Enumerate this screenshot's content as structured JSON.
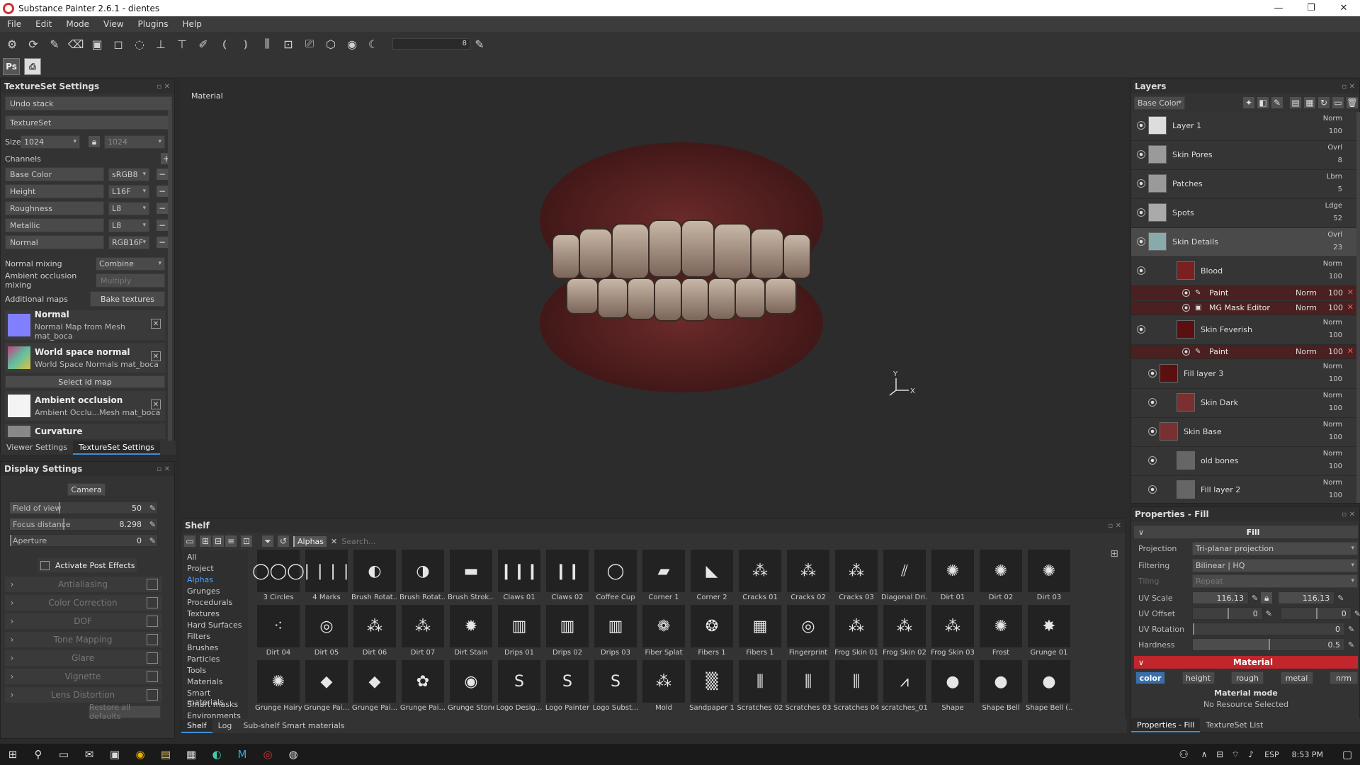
{
  "window": {
    "title": "Substance Painter 2.6.1 - dientes",
    "minimize": "—",
    "maximize": "❐",
    "close": "✕"
  },
  "menu": [
    "File",
    "Edit",
    "Mode",
    "View",
    "Plugins",
    "Help"
  ],
  "toolbar": {
    "brush_size": "8",
    "ps_label": "Ps"
  },
  "textureset": {
    "title": "TextureSet Settings",
    "undo_stack": "Undo stack",
    "textureset_label": "TextureSet",
    "size_label": "Size",
    "size_value": "1024",
    "size_value2": "1024",
    "channels_label": "Channels",
    "channels": [
      {
        "name": "Base Color",
        "format": "sRGB8"
      },
      {
        "name": "Height",
        "format": "L16F"
      },
      {
        "name": "Roughness",
        "format": "L8"
      },
      {
        "name": "Metallic",
        "format": "L8"
      },
      {
        "name": "Normal",
        "format": "RGB16F"
      }
    ],
    "normal_mixing_label": "Normal mixing",
    "normal_mixing_value": "Combine",
    "ao_mixing_label": "Ambient occlusion mixing",
    "ao_mixing_value": "Multiply",
    "additional_maps_label": "Additional maps",
    "bake_button": "Bake textures",
    "maps": [
      {
        "title": "Normal",
        "desc": "Normal Map from Mesh mat_boca",
        "color": "#8080ff"
      },
      {
        "title": "World space normal",
        "desc": "World Space Normals mat_boca",
        "color": "#c060a0"
      }
    ],
    "select_id_map": "Select id map",
    "maps2": [
      {
        "title": "Ambient occlusion",
        "desc": "Ambient Occlu...Mesh mat_boca"
      },
      {
        "title": "Curvature",
        "desc": ""
      }
    ],
    "tabs": [
      "Viewer Settings",
      "TextureSet Settings"
    ]
  },
  "display": {
    "title": "Display Settings",
    "camera_button": "Camera",
    "sliders": [
      {
        "label": "Field of view",
        "value": "50",
        "fraction": 0.33
      },
      {
        "label": "Focus distance",
        "value": "8.298",
        "fraction": 0.36
      },
      {
        "label": "Aperture",
        "value": "0",
        "fraction": 0.0
      }
    ],
    "activate_post": "Activate Post Effects",
    "effects": [
      "Antialiasing",
      "Color Correction",
      "DOF",
      "Tone Mapping",
      "Glare",
      "Vignette",
      "Lens Distortion"
    ],
    "restore": "Restore all defaults"
  },
  "viewport": {
    "label": "Material",
    "axis_y": "Y",
    "axis_x": "X"
  },
  "layers": {
    "title": "Layers",
    "channel": "Base Color",
    "items": [
      {
        "name": "Layer 1",
        "blend": "Norm",
        "opacity": "100"
      },
      {
        "name": "Skin Pores",
        "blend": "Ovrl",
        "opacity": "8"
      },
      {
        "name": "Patches",
        "blend": "Lbrn",
        "opacity": "5"
      },
      {
        "name": "Spots",
        "blend": "Ldge",
        "opacity": "52"
      },
      {
        "name": "Skin Details",
        "blend": "Ovrl",
        "opacity": "23"
      },
      {
        "name": "Blood",
        "blend": "Norm",
        "opacity": "100"
      }
    ],
    "blood_subs": [
      {
        "name": "Paint",
        "blend": "Norm",
        "opacity": "100"
      },
      {
        "name": "MG Mask Editor",
        "blend": "Norm",
        "opacity": "100"
      }
    ],
    "feverish": {
      "name": "Skin Feverish",
      "blend": "Norm",
      "opacity": "100"
    },
    "feverish_sub": {
      "name": "Paint",
      "blend": "Norm",
      "opacity": "100"
    },
    "items2": [
      {
        "name": "Fill layer 3",
        "blend": "Norm",
        "opacity": "100"
      },
      {
        "name": "Skin Dark",
        "blend": "Norm",
        "opacity": "100"
      },
      {
        "name": "Skin Base",
        "blend": "Norm",
        "opacity": "100"
      },
      {
        "name": "old bones",
        "blend": "Norm",
        "opacity": "100"
      },
      {
        "name": "Fill layer 2",
        "blend": "Norm",
        "opacity": "100"
      }
    ]
  },
  "properties": {
    "title": "Properties - Fill",
    "fill_header": "Fill",
    "projection_label": "Projection",
    "projection_value": "Tri-planar projection",
    "filtering_label": "Filtering",
    "filtering_value": "Bilinear | HQ",
    "tiling_label": "Tiling",
    "tiling_value": "Repeat",
    "uv_scale_label": "UV Scale",
    "uv_scale_value": "116.13",
    "uv_scale_value2": "116.13",
    "uv_offset_label": "UV Offset",
    "uv_offset_value": "0",
    "uv_offset_value2": "0",
    "uv_rotation_label": "UV Rotation",
    "uv_rotation_value": "0",
    "hardness_label": "Hardness",
    "hardness_value": "0.5",
    "material_header": "Material",
    "channel_buttons": [
      "color",
      "height",
      "rough",
      "metal",
      "nrm"
    ],
    "material_mode": "Material mode",
    "no_resource": "No Resource Selected",
    "tabs": [
      "Properties - Fill",
      "TextureSet List"
    ]
  },
  "shelf": {
    "title": "Shelf",
    "filter_tag": "Alphas",
    "search_placeholder": "Search...",
    "categories": [
      "All",
      "Project",
      "Alphas",
      "Grunges",
      "Procedurals",
      "Textures",
      "Hard Surfaces",
      "Filters",
      "Brushes",
      "Particles",
      "Tools",
      "Materials",
      "Smart materials",
      "Smart masks",
      "Environments"
    ],
    "selected_category": "Alphas",
    "assets": [
      "3 Circles",
      "4 Marks",
      "Brush Rotat...",
      "Brush Rotat...",
      "Brush Strok...",
      "Claws 01",
      "Claws 02",
      "Coffee Cup",
      "Corner 1",
      "Corner 2",
      "Cracks 01",
      "Cracks 02",
      "Cracks 03",
      "Diagonal Dri...",
      "Dirt 01",
      "Dirt 02",
      "Dirt 03",
      "Dirt 04",
      "Dirt 05",
      "Dirt 06",
      "Dirt 07",
      "Dirt Stain",
      "Drips 01",
      "Drips 02",
      "Drips 03",
      "Fiber Splat",
      "Fibers 1",
      "Fibers 1",
      "Fingerprint",
      "Frog Skin 01",
      "Frog Skin 02",
      "Frog Skin 03",
      "Frost",
      "Grunge 01",
      "Grunge Hairy",
      "Grunge Pai...",
      "Grunge Pai...",
      "Grunge Pai...",
      "Grunge Stone",
      "Logo Desig...",
      "Logo Painter",
      "Logo Subst...",
      "Mold",
      "Sandpaper 1",
      "Scratches 02",
      "Scratches 03",
      "Scratches 04",
      "scratches_01",
      "Shape",
      "Shape Bell",
      "Shape Bell (..."
    ],
    "tabs": [
      "Shelf",
      "Log",
      "Sub-shelf Smart materials"
    ]
  },
  "taskbar": {
    "lang": "ESP",
    "time": "8:53 PM"
  }
}
